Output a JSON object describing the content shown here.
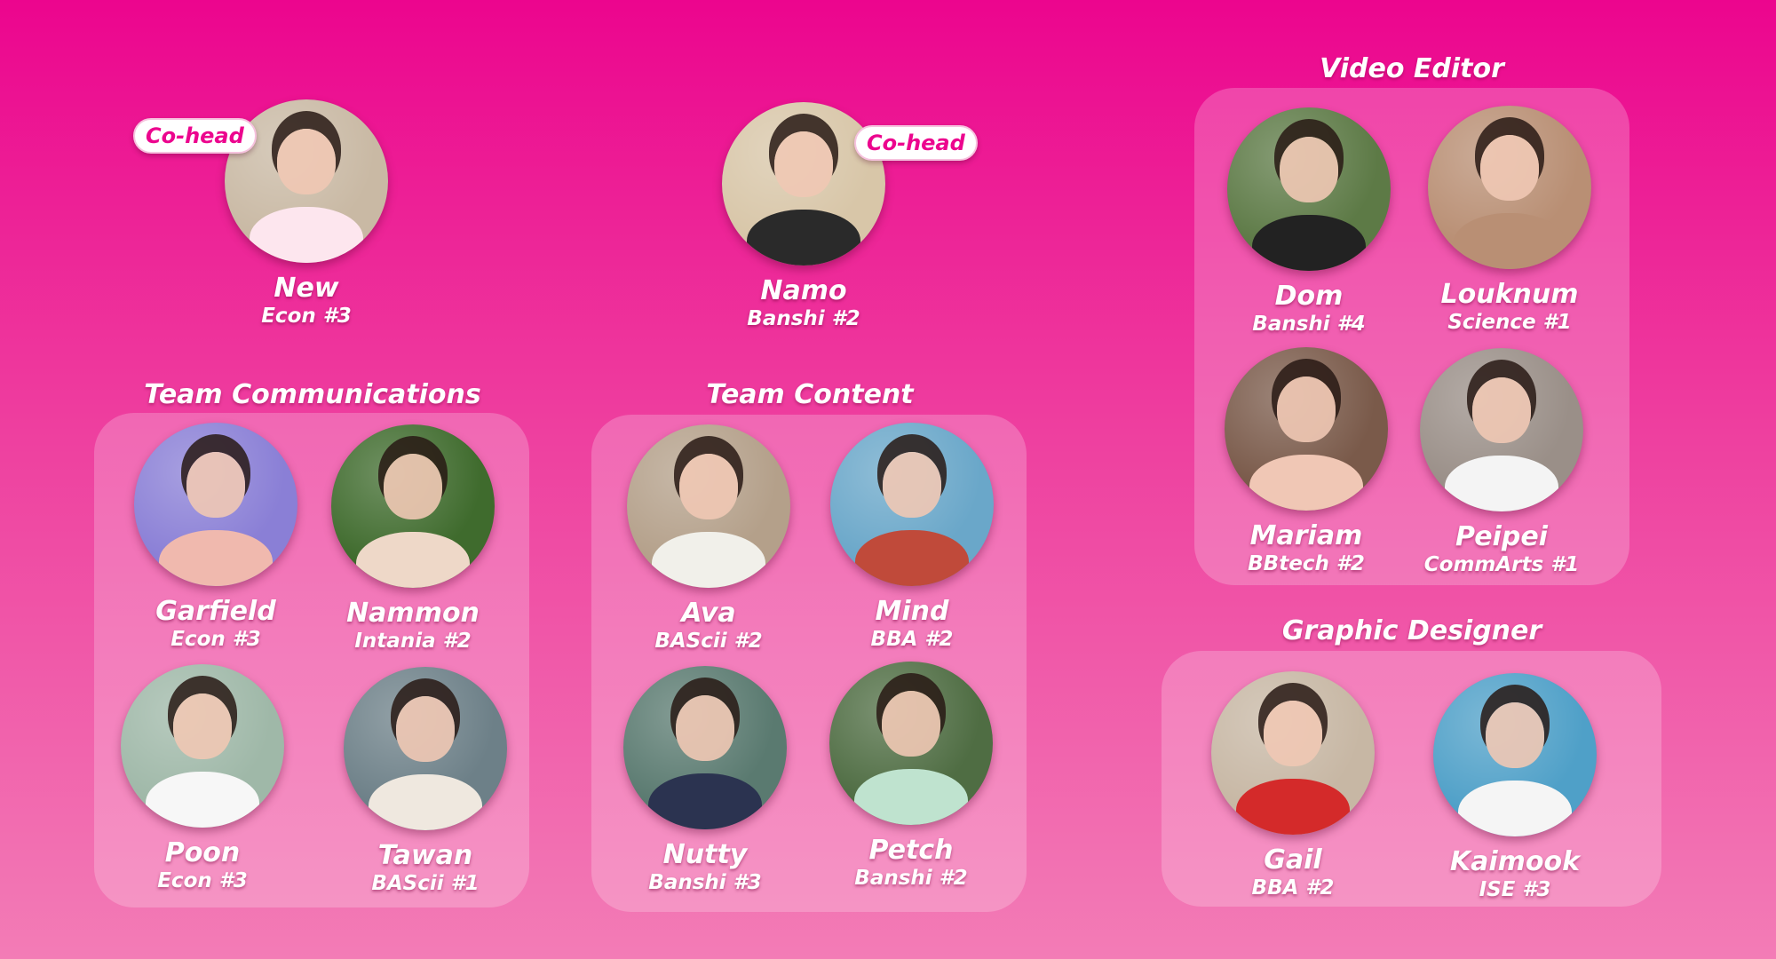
{
  "leads": [
    {
      "name": "New",
      "faculty": "Econ #3",
      "badge": "Co-head",
      "bg": "#c9b9a4",
      "top": "#fde6ee"
    },
    {
      "name": "Namo",
      "faculty": "Banshi #2",
      "badge": "Co-head",
      "bg": "#d8c6a8",
      "top": "#2a2a2a"
    }
  ],
  "teams": {
    "communications": {
      "title": "Team Communications",
      "members": [
        {
          "name": "Garfield",
          "faculty": "Econ #3",
          "bg": "#8a7fd6",
          "top": "#f0b9ae"
        },
        {
          "name": "Nammon",
          "faculty": "Intania #2",
          "bg": "#3f6b2d",
          "top": "#eed8c8"
        },
        {
          "name": "Poon",
          "faculty": "Econ #3",
          "bg": "#9fb8a8",
          "top": "#f7f7f7"
        },
        {
          "name": "Tawan",
          "faculty": "BAScii #1",
          "bg": "#6d8088",
          "top": "#efe8df"
        }
      ]
    },
    "content": {
      "title": "Team Content",
      "members": [
        {
          "name": "Ava",
          "faculty": "BAScii #2",
          "bg": "#b4a08a",
          "top": "#f1f0ea"
        },
        {
          "name": "Mind",
          "faculty": "BBA #2",
          "bg": "#6aa7c9",
          "top": "#c04a3a"
        },
        {
          "name": "Nutty",
          "faculty": "Banshi #3",
          "bg": "#5a7a70",
          "top": "#2b3350"
        },
        {
          "name": "Petch",
          "faculty": "Banshi #2",
          "bg": "#4f6d43",
          "top": "#bfe3cf"
        }
      ]
    },
    "video": {
      "title": "Video Editor",
      "members": [
        {
          "name": "Dom",
          "faculty": "Banshi #4",
          "bg": "#5d7a46",
          "top": "#222222"
        },
        {
          "name": "Louknum",
          "faculty": "Science #1",
          "bg": "#b98f74",
          "top": "#b98f74"
        },
        {
          "name": "Mariam",
          "faculty": "BBtech #2",
          "bg": "#7a5a4a",
          "top": "#f0c7b5"
        },
        {
          "name": "Peipei",
          "faculty": "CommArts #1",
          "bg": "#9a8f88",
          "top": "#f4f4f4"
        }
      ]
    },
    "graphic": {
      "title": "Graphic Designer",
      "members": [
        {
          "name": "Gail",
          "faculty": "BBA #2",
          "bg": "#c7b7a4",
          "top": "#d42a2a"
        },
        {
          "name": "Kaimook",
          "faculty": "ISE #3",
          "bg": "#4fa0c8",
          "top": "#f5f5f5"
        }
      ]
    }
  },
  "colors": {
    "background_top": "#ec058e",
    "background_bottom": "#f37cb6",
    "badge_text": "#ec058e"
  }
}
